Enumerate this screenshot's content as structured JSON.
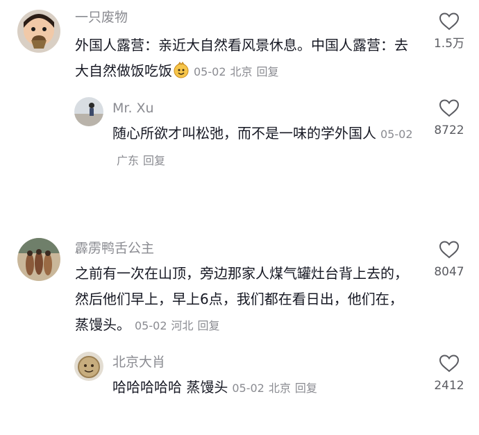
{
  "comments": [
    {
      "username": "一只废物",
      "text": "外国人露营：亲近大自然看风景休息。中国人露营：去大自然做饭吃饭",
      "date": "05-02",
      "location": "北京",
      "reply_label": "回复",
      "likes": "1.5万",
      "emoji": "smiling-cartoon-face",
      "replies": [
        {
          "username": "Mr. Xu",
          "text": "随心所欲才叫松弛，而不是一味的学外国人",
          "date": "05-02",
          "location": "广东",
          "reply_label": "回复",
          "likes": "8722"
        }
      ]
    },
    {
      "username": "霹雳鸭舌公主",
      "text": "之前有一次在山顶，旁边那家人煤气罐灶台背上去的，然后他们早上，早上6点，我们都在看日出，他们在，蒸馒头。",
      "date": "05-02",
      "location": "河北",
      "reply_label": "回复",
      "likes": "8047",
      "replies": [
        {
          "username": "北京大肖",
          "text": "哈哈哈哈哈 蒸馒头",
          "date": "05-02",
          "location": "北京",
          "reply_label": "回复",
          "likes": "2412"
        }
      ]
    }
  ],
  "icons": {
    "like": "heart-outline-icon"
  },
  "colors": {
    "text": "#161823",
    "meta": "#8a8b91",
    "count": "#5a5b61"
  }
}
